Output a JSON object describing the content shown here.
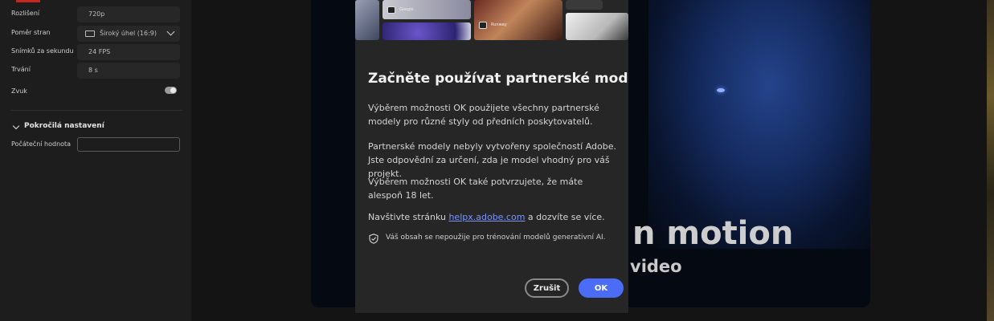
{
  "sidebar": {
    "resolution": {
      "label": "Rozlišení",
      "value": "720p"
    },
    "aspect_ratio": {
      "label": "Poměr stran",
      "value": "Široký úhel (16:9)"
    },
    "fps": {
      "label": "Snímků za sekundu",
      "value": "24 FPS"
    },
    "duration": {
      "label": "Trvání",
      "value": "8 s"
    },
    "sound": {
      "label": "Zvuk",
      "enabled": true
    },
    "advanced": {
      "title": "Pokročilá nastavení"
    },
    "seed": {
      "label": "Počáteční hodnota",
      "value": ""
    }
  },
  "preview": {
    "headline": "n motion",
    "subline": "video"
  },
  "dialog": {
    "thumbnails": [
      {
        "icon": "google-logo-icon",
        "label": "Google"
      },
      {
        "icon": "runway-logo-icon",
        "label": "Runway"
      }
    ],
    "title": "Začněte používat partnerské modely",
    "para1": "Výběrem možnosti OK použijete všechny partnerské modely pro různé styly od předních poskytovatelů.",
    "para2": "Partnerské modely nebyly vytvořeny společností Adobe. Jste odpovědní za určení, zda je model vhodný pro váš projekt.",
    "para3": "Výběrem možnosti OK také potvrzujete, že máte alespoň 18 let.",
    "para4_prefix": "Navštivte stránku ",
    "para4_link": "helpx.adobe.com",
    "para4_suffix": " a dozvíte se více.",
    "note": "Váš obsah se nepoužije pro trénování modelů generativní AI.",
    "cancel_label": "Zrušit",
    "ok_label": "OK"
  },
  "colors": {
    "accent": "#4b6cf6",
    "brand_red": "#c4281c",
    "link": "#7a94ff"
  }
}
